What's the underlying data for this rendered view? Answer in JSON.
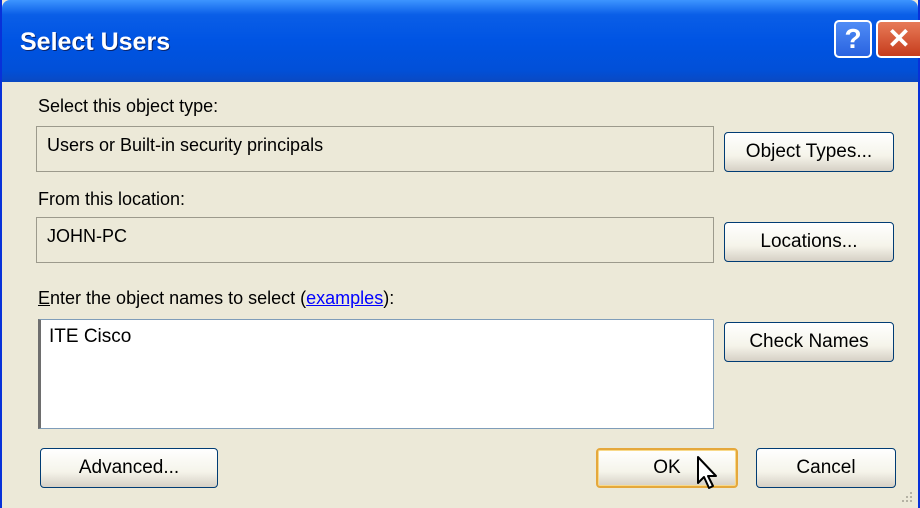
{
  "window": {
    "title": "Select Users",
    "help_glyph": "?",
    "close_glyph": "✕"
  },
  "object_type": {
    "label": "Select this object type:",
    "value": "Users or Built-in security principals",
    "button": "Object Types..."
  },
  "location": {
    "label": "From this location:",
    "value": "JOHN-PC",
    "button": "Locations..."
  },
  "names": {
    "label_first_char": "E",
    "label_rest": "nter the object names to select (",
    "link": "examples",
    "label_end": "):",
    "value": "ITE Cisco",
    "check_button": "Check Names"
  },
  "footer": {
    "advanced_button": "Advanced...",
    "ok_button": "OK",
    "cancel_button": "Cancel"
  },
  "colors": {
    "titlebar": "#0054e3",
    "dialog_bg": "#ece9d8",
    "link": "#0000ff"
  }
}
